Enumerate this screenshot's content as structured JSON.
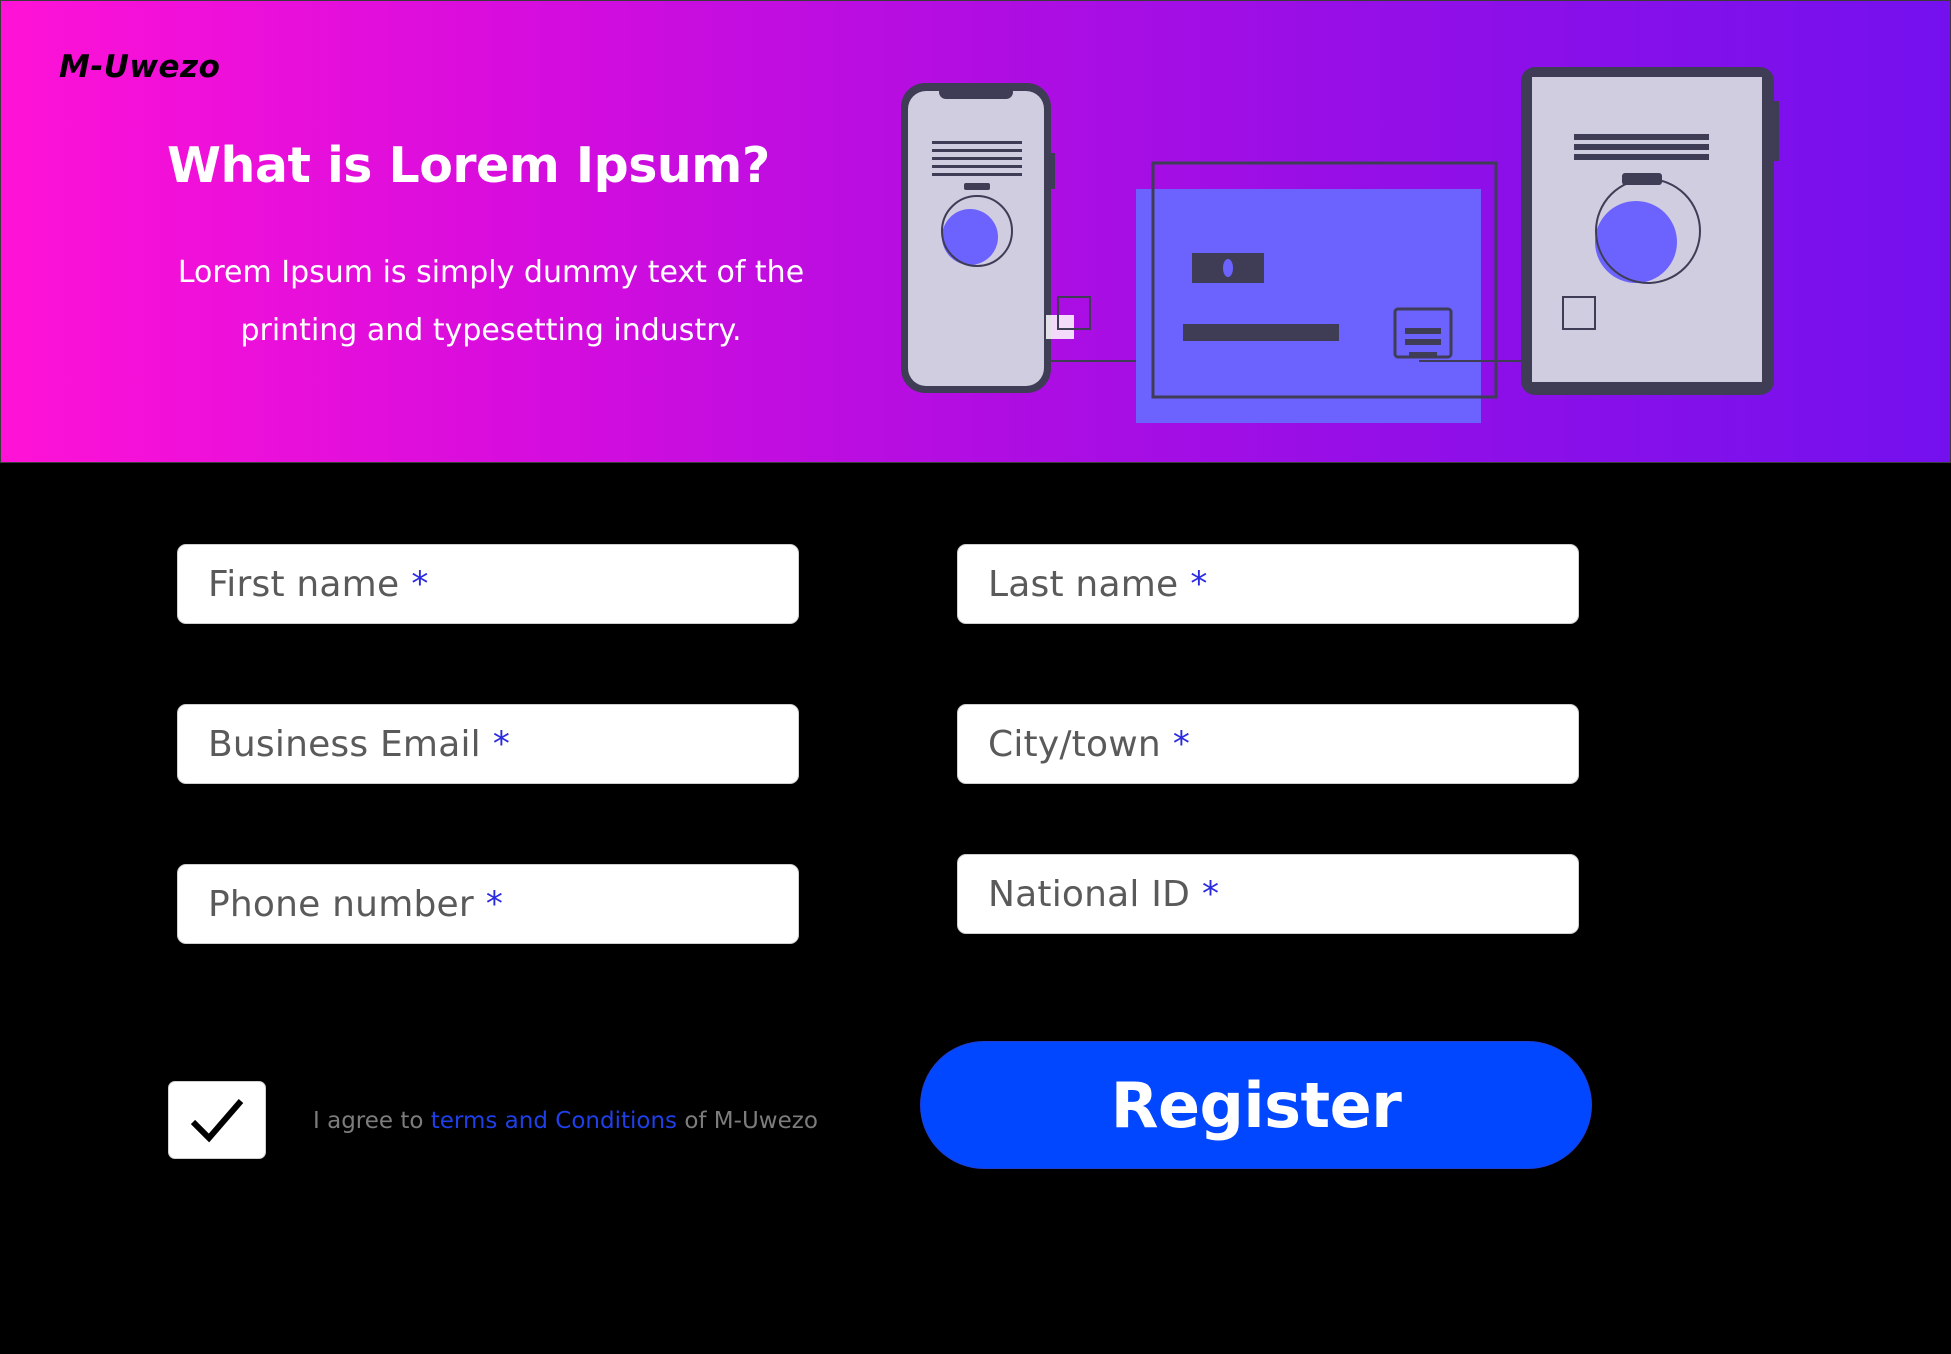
{
  "brand": {
    "logo_text": "M-Uwezo"
  },
  "hero": {
    "title": "What is Lorem Ipsum?",
    "description": "Lorem Ipsum is simply dummy text of the printing and typesetting industry."
  },
  "form": {
    "required_mark": "*",
    "fields": [
      {
        "placeholder": "First name"
      },
      {
        "placeholder": "Last name"
      },
      {
        "placeholder": "Business Email"
      },
      {
        "placeholder": "City/town"
      },
      {
        "placeholder": "Phone number"
      },
      {
        "placeholder": "National ID"
      }
    ],
    "agreement": {
      "checked": true,
      "prefix": "I agree to",
      "link": "terms and Conditions",
      "suffix": "of M-Uwezo"
    },
    "submit_label": "Register"
  },
  "colors": {
    "hero_gradient_start": "#ff12d6",
    "hero_gradient_end": "#7410ee",
    "accent_blue": "#0047ff",
    "required_mark": "#2a2ae0",
    "link": "#1f3fe8",
    "illustration_accent": "#6c63ff",
    "illustration_dark": "#3f3d56",
    "device_screen": "#d0cde1"
  },
  "icons": {
    "checkbox": "checkmark-icon",
    "illustration": "devices-illustration"
  }
}
